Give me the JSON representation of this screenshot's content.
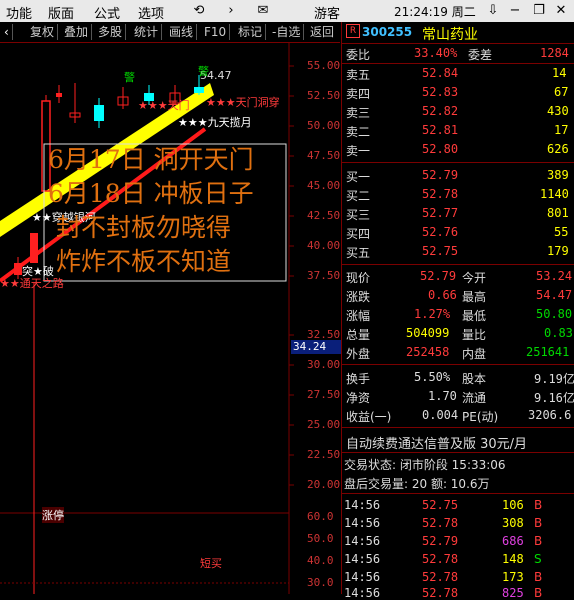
{
  "menu": {
    "items": [
      "功能",
      "版面",
      "公式",
      "选项"
    ],
    "guest": "游客",
    "clock": "21:24:19 周二"
  },
  "toolbar": {
    "buttons": [
      "复权",
      "叠加",
      "多股",
      "统计",
      "画线",
      "F10",
      "标记",
      "-自选",
      "返回"
    ]
  },
  "chart": {
    "price_axis": [
      "55.00",
      "52.50",
      "50.00",
      "47.50",
      "45.00",
      "42.50",
      "40.00",
      "37.50",
      "34.24",
      "32.50",
      "30.00",
      "27.50",
      "25.00",
      "22.50",
      "20.00"
    ],
    "lower_axis": [
      "60.0",
      "50.0",
      "40.0",
      "30.0"
    ],
    "current_marker": "34.24",
    "high_label": "54.47",
    "overlay_lines": [
      "6月17日 洞开天门",
      "6月18日 冲板日子",
      "封不封板勿晓得",
      "炸炸不板不知道"
    ],
    "annotations": {
      "tianmen": "★★★天门洞穿",
      "jiutian": "★★★九天揽月",
      "chuanyue": "★★穿越银河",
      "tongtian": "★★通天之路",
      "tu_po": "突★破",
      "warn1": "警",
      "warn2": "警",
      "zhangting": "涨停",
      "duanmai": "短买"
    }
  },
  "quote": {
    "code": "300255",
    "name": "常山药业",
    "weibi_label": "委比",
    "weibi": "33.40%",
    "weicha_label": "委差",
    "weicha": "1284",
    "asks": [
      {
        "label": "卖五",
        "price": "52.84",
        "vol": "14"
      },
      {
        "label": "卖四",
        "price": "52.83",
        "vol": "67"
      },
      {
        "label": "卖三",
        "price": "52.82",
        "vol": "430"
      },
      {
        "label": "卖二",
        "price": "52.81",
        "vol": "17"
      },
      {
        "label": "卖一",
        "price": "52.80",
        "vol": "626"
      }
    ],
    "bids": [
      {
        "label": "买一",
        "price": "52.79",
        "vol": "389"
      },
      {
        "label": "买二",
        "price": "52.78",
        "vol": "1140"
      },
      {
        "label": "买三",
        "price": "52.77",
        "vol": "801"
      },
      {
        "label": "买四",
        "price": "52.76",
        "vol": "55"
      },
      {
        "label": "买五",
        "price": "52.75",
        "vol": "179"
      }
    ],
    "stats": [
      {
        "l1": "现价",
        "v1": "52.79",
        "c1": "red",
        "l2": "今开",
        "v2": "53.24",
        "c2": "red"
      },
      {
        "l1": "涨跌",
        "v1": "0.66",
        "c1": "red",
        "l2": "最高",
        "v2": "54.47",
        "c2": "red"
      },
      {
        "l1": "涨幅",
        "v1": "1.27%",
        "c1": "red",
        "l2": "最低",
        "v2": "50.80",
        "c2": "green"
      },
      {
        "l1": "总量",
        "v1": "504099",
        "c1": "yellow",
        "l2": "量比",
        "v2": "0.83",
        "c2": "green"
      },
      {
        "l1": "外盘",
        "v1": "252458",
        "c1": "red",
        "l2": "内盘",
        "v2": "251641",
        "c2": "green"
      }
    ],
    "fin": [
      {
        "l1": "换手",
        "v1": "5.50%",
        "l2": "股本",
        "v2": "9.19亿"
      },
      {
        "l1": "净资",
        "v1": "1.70",
        "l2": "流通",
        "v2": "9.16亿"
      },
      {
        "l1": "收益(一)",
        "v1": "0.004",
        "l2": "PE(动)",
        "v2": "3206.6"
      }
    ],
    "promo": "自动续费通达信普及版 30元/月",
    "trade_status": "交易状态: 闭市阶段 15:33:06",
    "after_hours": "盘后交易量: 20 额: 10.6万",
    "ticks": [
      {
        "time": "14:56",
        "price": "52.75",
        "vol": "106",
        "side": "B",
        "vcolor": "yellow",
        "scolor": "red"
      },
      {
        "time": "14:56",
        "price": "52.78",
        "vol": "308",
        "side": "B",
        "vcolor": "yellow",
        "scolor": "red"
      },
      {
        "time": "14:56",
        "price": "52.79",
        "vol": "686",
        "side": "B",
        "vcolor": "purple",
        "scolor": "red"
      },
      {
        "time": "14:56",
        "price": "52.78",
        "vol": "148",
        "side": "S",
        "vcolor": "yellow",
        "scolor": "green"
      },
      {
        "time": "14:56",
        "price": "52.78",
        "vol": "173",
        "side": "B",
        "vcolor": "yellow",
        "scolor": "red"
      },
      {
        "time": "14:56",
        "price": "52.78",
        "vol": "825",
        "side": "B",
        "vcolor": "purple",
        "scolor": "red"
      }
    ]
  }
}
